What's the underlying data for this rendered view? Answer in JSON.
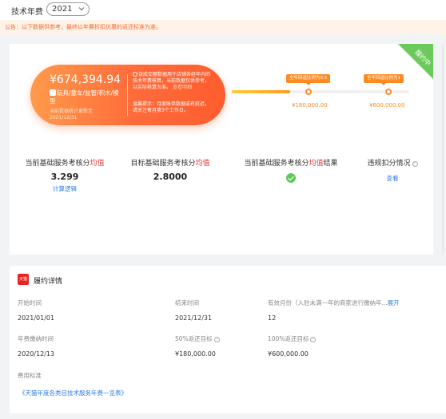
{
  "header": {
    "label": "技术年费",
    "year": "2021"
  },
  "notice": {
    "text": "公告：以下数据供参考，最终以年費折扣优惠的返还标准为准。"
  },
  "status_ribbon": {
    "text": "履约中"
  },
  "fee": {
    "amount": "¥674,394.94",
    "categories": "玩具/童车/益智/积木/模型",
    "update": "当前数据统计更新至2021/12/31",
    "note": "该成交额数据用于店铺各经年内的技术年费核算，当前数据仅供参考，以实际核算为准。",
    "note_link": "查看明细",
    "tip": "温馨提示：月度账单数据或有延迟，请关注每月第3个工作日。"
  },
  "progress": {
    "fill_fraction": 0.33,
    "points": [
      {
        "tip": "全年回返比例为0.5",
        "value": "¥180,000.00"
      },
      {
        "tip": "全年回返比例为1",
        "value": "¥600,000.00"
      }
    ]
  },
  "metrics": [
    {
      "label_pre": "当前基础服务考核分",
      "label_hl": "均值",
      "label_post": "",
      "value": "3.299",
      "link": "计算逻辑"
    },
    {
      "label_pre": "目标基础服务考核分",
      "label_hl": "均值",
      "label_post": "",
      "value": "2.8000"
    },
    {
      "label_pre": "当前基础服务考核分",
      "label_hl": "均值",
      "label_post": "结果",
      "status": "passed"
    },
    {
      "label_pre": "违规扣分情况",
      "info": "i",
      "link": "查看"
    }
  ],
  "details": {
    "title": "履约详情",
    "logo_text": "天猫",
    "start_label": "开始时间",
    "start_value": "2021/01/01",
    "end_label": "结束时间",
    "end_value": "2021/12/31",
    "months_label": "有效月份（入驻未满一年的商家进行缴纳年...",
    "months_more": "展开",
    "months_value": "12",
    "paytime_label": "年费缴纳时间",
    "paytime_value": "2020/12/13",
    "target50_label": "50%返还目标",
    "target50_value": "¥180,000.00",
    "target100_label": "100%返还目标",
    "target100_value": "¥600,000.00",
    "std_label": "费用标准",
    "std_link": "《天猫年度各类目技术服务年费一览表》"
  },
  "colors": {
    "accent": "#ff8a22",
    "brand_red": "#e4393c",
    "link": "#2f7ce8",
    "success": "#5fc95f"
  },
  "icons": [
    "chevron-down-icon",
    "info-icon",
    "check-circle-icon",
    "tmall-logo"
  ]
}
